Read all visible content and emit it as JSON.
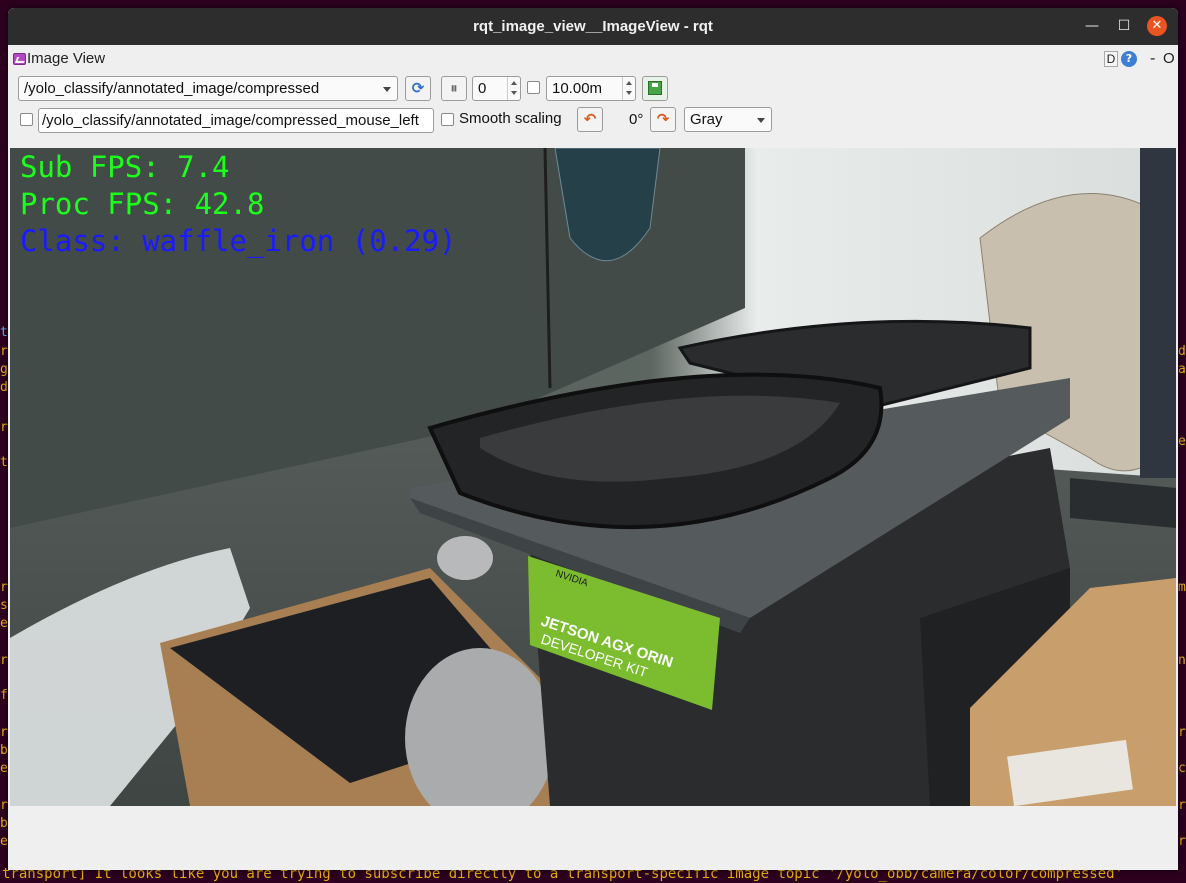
{
  "terminal": {
    "bottom_line": "transport] It looks like you are trying to subscribe directly to a transport-specific image topic '/yolo_obb/camera/color/compressed'"
  },
  "window": {
    "title": "rqt_image_view__ImageView - rqt",
    "min_glyph": "—",
    "max_glyph": "☐",
    "close_glyph": "✕"
  },
  "dock": {
    "title": "Image View",
    "d_label": "D",
    "help_label": "?",
    "dash_label": "-",
    "o_label": "O"
  },
  "toolbar": {
    "topic_value": "/yolo_classify/annotated_image/compressed",
    "refresh_glyph": "⟳",
    "pause_glyph": "⏸",
    "num_value": "0",
    "max_value": "10.00m",
    "mouse_topic_value": "/yolo_classify/annotated_image/compressed_mouse_left",
    "smooth_label": "Smooth scaling",
    "rot_left_glyph": "↶",
    "rotation_label": "0°",
    "rot_right_glyph": "↷",
    "color_scheme_value": "Gray"
  },
  "overlay": {
    "sub_fps": "Sub FPS: 7.4",
    "proc_fps": "Proc FPS: 42.8",
    "class_text": "Class: waffle_iron (0.29)"
  },
  "camera_scene": {
    "box_label_line1": "JETSON AGX ORIN",
    "box_label_line2": "DEVELOPER KIT",
    "brand_label": "NVIDIA"
  }
}
